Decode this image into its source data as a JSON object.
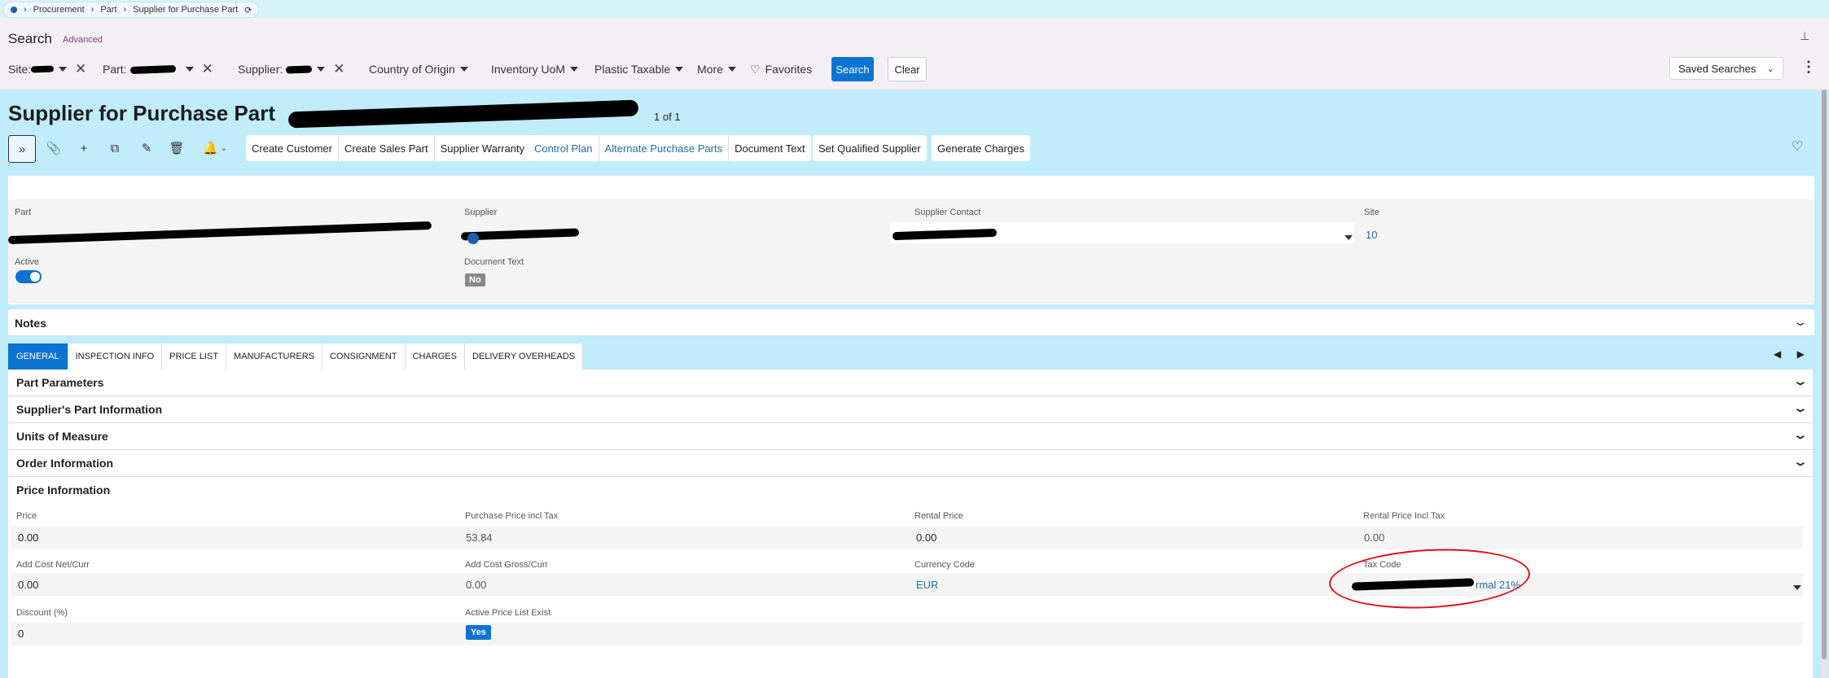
{
  "breadcrumb": [
    "Procurement",
    "Part",
    "Supplier for Purchase Part"
  ],
  "search": {
    "title": "Search",
    "advanced_label": "Advanced",
    "filters": {
      "site": "Site:",
      "part": "Part:",
      "supplier": "Supplier:",
      "country": "Country of Origin",
      "inventory_uom": "Inventory UoM",
      "plastic": "Plastic Taxable",
      "more": "More",
      "favorites": "Favorites"
    },
    "search_button": "Search",
    "clear_button": "Clear",
    "saved_searches": "Saved Searches"
  },
  "page": {
    "title": "Supplier for Purchase Part",
    "counter": "1 of 1"
  },
  "toolbar": {
    "commands_a": [
      "Create Customer",
      "Create Sales Part",
      "Supplier Warranty"
    ],
    "commands_b": [
      "Control Plan",
      "Alternate Purchase Parts",
      "Document Text"
    ],
    "set_qualified": "Set Qualified Supplier",
    "generate_charges": "Generate Charges"
  },
  "header": {
    "part_label": "Part",
    "supplier_label": "Supplier",
    "contact_label": "Supplier Contact",
    "site_label": "Site",
    "site_value": "10",
    "active_label": "Active",
    "doc_text_label": "Document Text",
    "doc_text_value": "No"
  },
  "notes_label": "Notes",
  "tabs": [
    "GENERAL",
    "INSPECTION INFO",
    "PRICE LIST",
    "MANUFACTURERS",
    "CONSIGNMENT",
    "CHARGES",
    "DELIVERY OVERHEADS"
  ],
  "sections": [
    "Part Parameters",
    "Supplier's Part Information",
    "Units of Measure",
    "Order Information"
  ],
  "price": {
    "title": "Price Information",
    "price_label": "Price",
    "price_value": "0.00",
    "ppit_label": "Purchase Price incl Tax",
    "ppit_value": "53.84",
    "rental_label": "Rental Price",
    "rental_value": "0.00",
    "rpit_label": "Rental Price Incl Tax",
    "rpit_value": "0.00",
    "acn_label": "Add Cost Net/Curr",
    "acn_value": "0.00",
    "acg_label": "Add Cost Gross/Curr",
    "acg_value": "0.00",
    "currency_label": "Currency Code",
    "currency_value": "EUR",
    "tax_label": "Tax Code",
    "tax_value": "rmal 21%",
    "discount_label": "Discount (%)",
    "discount_value": "0",
    "aple_label": "Active Price List Exist",
    "aple_value": "Yes"
  },
  "colors": {
    "accent": "#0b73d0",
    "background": "#c0ecfb",
    "annotation": "#e0101a"
  }
}
